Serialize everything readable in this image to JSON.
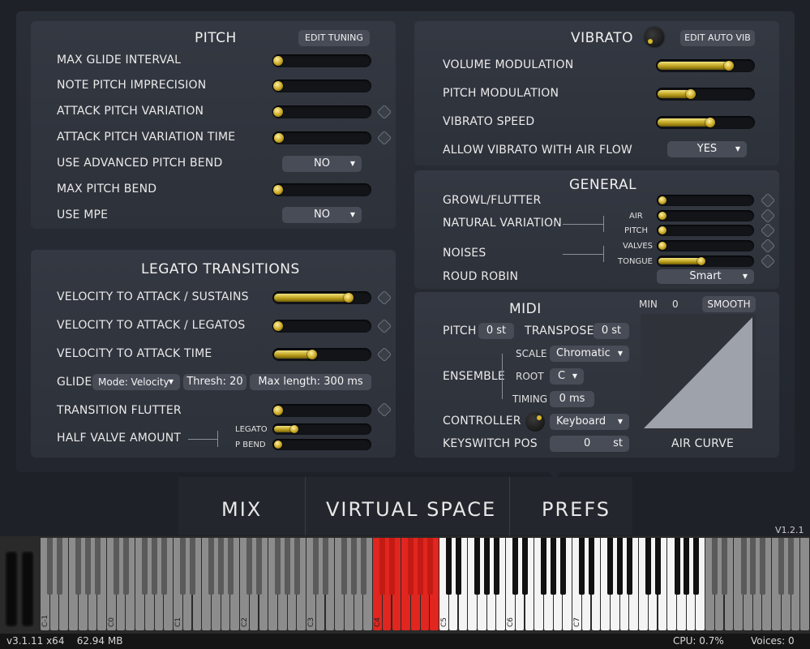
{
  "pitch": {
    "title": "PITCH",
    "edit_btn": "EDIT TUNING",
    "rows": [
      "MAX GLIDE INTERVAL",
      "NOTE PITCH IMPRECISION",
      "ATTACK PITCH VARIATION",
      "ATTACK PITCH VARIATION TIME",
      "USE ADVANCED PITCH BEND",
      "MAX PITCH BEND",
      "USE MPE"
    ],
    "adv_bend_value": "NO",
    "mpe_value": "NO"
  },
  "vibrato": {
    "title": "VIBRATO",
    "edit_btn": "EDIT AUTO VIB",
    "rows": [
      "VOLUME MODULATION",
      "PITCH MODULATION",
      "VIBRATO SPEED",
      "ALLOW VIBRATO WITH AIR FLOW"
    ],
    "air_flow_value": "YES"
  },
  "general": {
    "title": "GENERAL",
    "rows": [
      "GROWL/FLUTTER",
      "NATURAL VARIATION",
      "NOISES",
      "ROUD ROBIN"
    ],
    "sub": [
      "AIR",
      "PITCH",
      "VALVES",
      "TONGUE"
    ],
    "round_robin_value": "Smart"
  },
  "legato": {
    "title": "LEGATO TRANSITIONS",
    "rows": [
      "VELOCITY TO ATTACK / SUSTAINS",
      "VELOCITY TO ATTACK / LEGATOS",
      "VELOCITY TO ATTACK TIME"
    ],
    "glide_label": "GLIDE",
    "glide_mode": "Mode: Velocity",
    "thresh": "Thresh: 20",
    "max_length": "Max length:  300 ms",
    "flutter": "TRANSITION FLUTTER",
    "half_valve": "HALF VALVE AMOUNT",
    "hv_sub": [
      "LEGATO",
      "P BEND"
    ]
  },
  "midi": {
    "title": "MIDI",
    "pitch_label": "PITCH",
    "pitch_value": "0 st",
    "transpose_label": "TRANSPOSE",
    "transpose_value": "0 st",
    "ensemble": "ENSEMBLE",
    "scale_label": "SCALE",
    "scale_value": "Chromatic",
    "root_label": "ROOT",
    "root_value": "C",
    "timing_label": "TIMING",
    "timing_value": "0 ms",
    "controller": "CONTROLLER",
    "controller_value": "Keyboard",
    "keyswitch": "KEYSWITCH POS",
    "keyswitch_value": "0",
    "keyswitch_unit": "st",
    "min_label": "MIN",
    "min_value": "0",
    "smooth_btn": "SMOOTH",
    "air_curve": "AIR CURVE"
  },
  "tabs": {
    "mix": "MIX",
    "virtual_space": "VIRTUAL SPACE",
    "prefs": "PREFS",
    "version": "V1.2.1"
  },
  "keyboard": {
    "octaves": [
      "C-1",
      "C0",
      "C1",
      "C2",
      "C3",
      "C4",
      "C5",
      "C6",
      "C7"
    ]
  },
  "status": {
    "left": "v3.1.11 x64    62.94 MB",
    "cpu": "CPU: 0.7%",
    "voices": "Voices: 0"
  },
  "levels": {
    "max_glide": 0.03,
    "note_imprecision": 0.03,
    "attack_var": 0.02,
    "attack_var_time": 0.1,
    "max_pitch_bend": 0.02,
    "vol_mod": 0.8,
    "pitch_mod": 0.4,
    "vib_speed": 0.6,
    "growl": 0.03,
    "air": 0.03,
    "gen_pitch": 0.03,
    "valves": 0.03,
    "tongue": 0.5,
    "vel_sustain": 0.83,
    "vel_legato": 0.03,
    "vel_time": 0.45,
    "flutter": 0.03,
    "hv_legato": 0.25,
    "hv_pbend": 0.03
  },
  "colors": {
    "accent": "#d8b92c",
    "active_key": "#e0261f"
  }
}
